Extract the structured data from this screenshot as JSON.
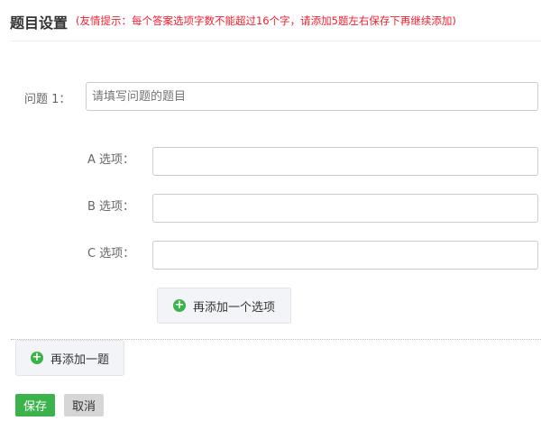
{
  "header": {
    "title": "题目设置",
    "hint": "(友情提示：每个答案选项字数不能超过16个字，请添加5题左右保存下再继续添加)"
  },
  "question": {
    "label": "问题  1：",
    "placeholder": "请填写问题的题目",
    "value": ""
  },
  "options": [
    {
      "label": "A  选项：",
      "value": ""
    },
    {
      "label": "B  选项：",
      "value": ""
    },
    {
      "label": "C  选项：",
      "value": ""
    }
  ],
  "buttons": {
    "add_option": "再添加一个选项",
    "add_question": "再添加一题",
    "save": "保存",
    "cancel": "取消"
  },
  "colors": {
    "accent": "#3bb34a",
    "hint": "#f21d2c"
  }
}
